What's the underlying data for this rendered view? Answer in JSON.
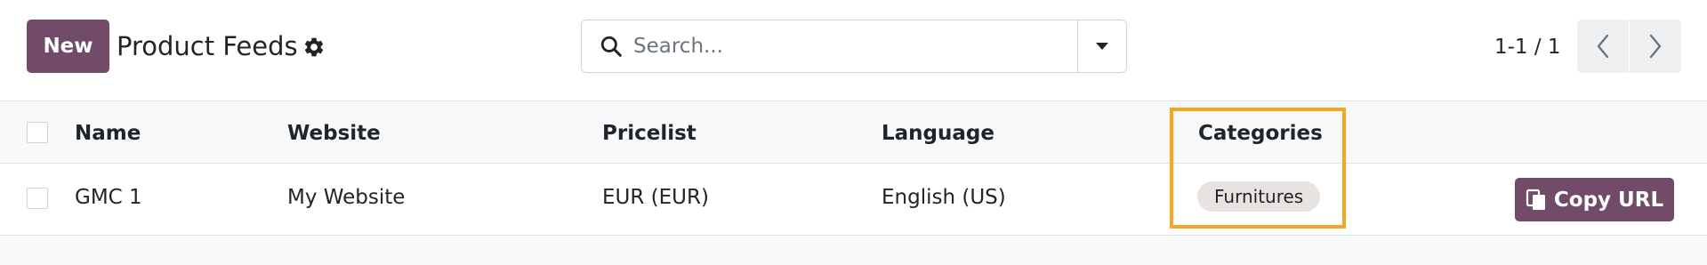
{
  "control_panel": {
    "new_label": "New",
    "title": "Product Feeds",
    "search_placeholder": "Search...",
    "pager_value": "1-1 / 1"
  },
  "table": {
    "headers": {
      "name": "Name",
      "website": "Website",
      "pricelist": "Pricelist",
      "language": "Language",
      "categories": "Categories"
    },
    "rows": [
      {
        "name": "GMC 1",
        "website": "My Website",
        "pricelist": "EUR (EUR)",
        "language": "English (US)",
        "categories": [
          "Furnitures"
        ],
        "action_label": "Copy URL"
      }
    ]
  },
  "icons": {
    "settings": "gear-icon",
    "search": "search-icon",
    "dropdown": "caret-down-icon",
    "pager_prev": "chevron-left-icon",
    "pager_next": "chevron-right-icon",
    "copy": "copy-icon"
  },
  "colors": {
    "primary": "#714b67",
    "highlight": "#f5a623",
    "tag_background": "#e8e2e1"
  }
}
